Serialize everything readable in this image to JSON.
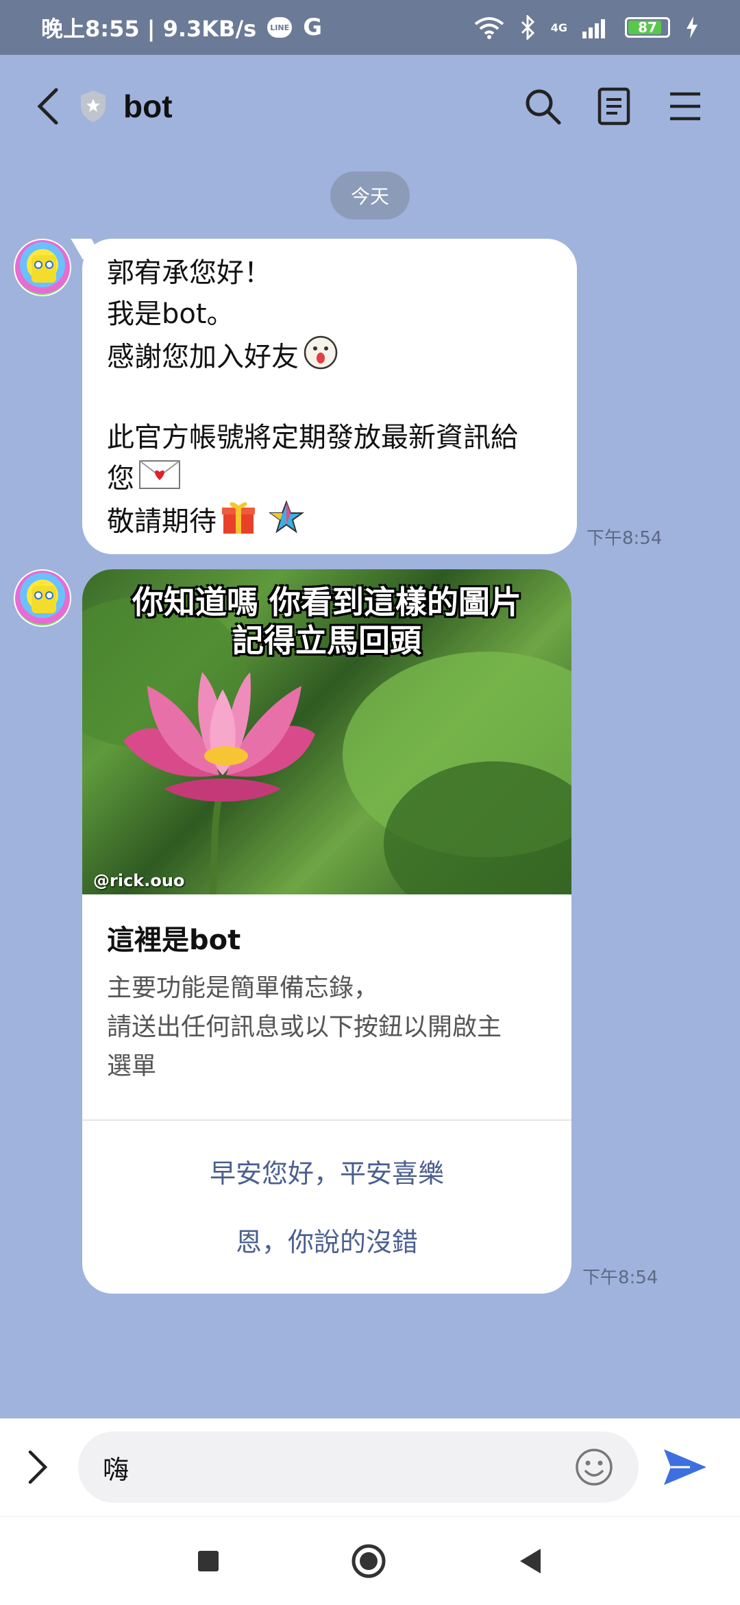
{
  "status_bar": {
    "time_speed": "晚上8:55 | 9.3KB/s",
    "line_badge": "LINE",
    "g_letter": "G",
    "network": "4G",
    "battery": "87"
  },
  "header": {
    "title": "bot"
  },
  "chat": {
    "date_label": "今天",
    "message1": {
      "lines": [
        "郭宥承您好！",
        "我是bot。",
        "感謝您加入好友",
        "",
        "此官方帳號將定期發放最新資訊給",
        "您",
        "敬請期待"
      ],
      "time": "下午8:54"
    },
    "card": {
      "image_caption_line1": "你知道嗎 你看到這樣的圖片",
      "image_caption_line2": "記得立馬回頭",
      "image_watermark": "@rick.ouo",
      "title": "這裡是bot",
      "desc_lines": [
        "主要功能是簡單備忘錄，",
        "請送出任何訊息或以下按鈕以開啟主",
        "選單"
      ],
      "button1": "早安您好，平安喜樂",
      "button2": "恩，你說的沒錯",
      "time": "下午8:54"
    }
  },
  "input": {
    "value": "嗨"
  },
  "icons": {
    "back": "chevron-left-icon",
    "shield": "shield-icon",
    "search": "search-icon",
    "notes": "notes-icon",
    "menu": "menu-icon",
    "expand": "chevron-right-icon",
    "emoji": "smiley-icon",
    "send": "send-icon"
  },
  "colors": {
    "chat_background": "#9fb3dd",
    "status_bar": "#6b7a96",
    "send_accent": "#3d6fe0",
    "card_button_text": "#4a5f8f"
  }
}
